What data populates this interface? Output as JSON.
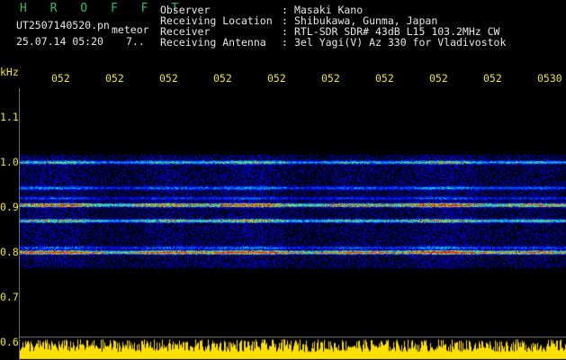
{
  "header": {
    "brand": "H R O F F T",
    "filename": "UT2507140520.pn",
    "tag": "meteor",
    "datetime": "25.07.14 05:20",
    "extra": "7..",
    "fields": [
      {
        "label": "Observer",
        "colon": ":",
        "value": "Masaki Kano"
      },
      {
        "label": "Receiving Location",
        "colon": ":",
        "value": "Shibukawa, Gunma, Japan"
      },
      {
        "label": "Receiver",
        "colon": ":",
        "value": "RTL-SDR SDR# 43dB L15 103.2MHz CW"
      },
      {
        "label": "Receiving Antenna",
        "colon": ":",
        "value": "3el Yagi(V) Az 330 for Vladivostok"
      }
    ]
  },
  "axis": {
    "unit": "kHz",
    "y_ticks": [
      "1.1",
      "1.0",
      "0.9",
      "0.8",
      "0.7",
      "0.6"
    ],
    "x_ticks": [
      "052",
      "052",
      "052",
      "052",
      "052",
      "052",
      "052",
      "052",
      "052",
      "0530"
    ]
  },
  "colors": {
    "background": "#000000",
    "tick_text": "#f0e040",
    "header_text": "#e8e8e8",
    "brand": "#2fbf5a",
    "noise_band": "#ffe000"
  }
}
